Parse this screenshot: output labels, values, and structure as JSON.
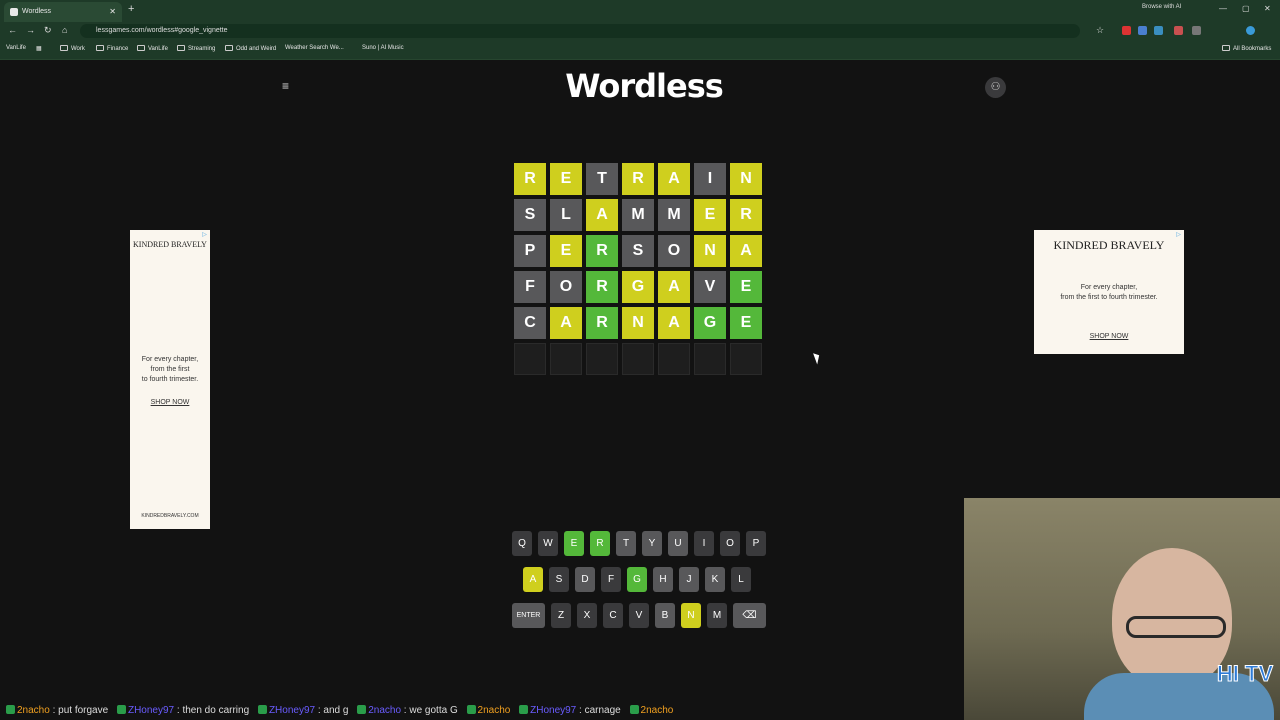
{
  "browser": {
    "tab_title": "Wordless",
    "new_tab": "+",
    "url": "lessgames.com/wordless#google_vignette",
    "browse_ai": "Browse with AI",
    "all_bookmarks": "All Bookmarks",
    "bookmarks": [
      "VanLife",
      "Work",
      "Finance",
      "VanLife",
      "Streaming",
      "Odd and Weird",
      "Weather Search We...",
      "Suno | AI Music"
    ]
  },
  "app": {
    "title": "Wordless",
    "menu_icon": "hamburger-icon",
    "account_icon": "user-icon"
  },
  "colors": {
    "green": "#54b83a",
    "yellow": "#cfcf1e",
    "gray": "#58585a",
    "empty": "#1e1e1e",
    "key_unused": "#3a3a3c"
  },
  "board": {
    "rows": [
      {
        "letters": [
          "R",
          "E",
          "T",
          "R",
          "A",
          "I",
          "N"
        ],
        "states": [
          "y",
          "y",
          "x",
          "y",
          "y",
          "x",
          "y"
        ]
      },
      {
        "letters": [
          "S",
          "L",
          "A",
          "M",
          "M",
          "E",
          "R"
        ],
        "states": [
          "x",
          "x",
          "y",
          "x",
          "x",
          "y",
          "y"
        ]
      },
      {
        "letters": [
          "P",
          "E",
          "R",
          "S",
          "O",
          "N",
          "A"
        ],
        "states": [
          "x",
          "y",
          "g",
          "x",
          "x",
          "y",
          "y"
        ]
      },
      {
        "letters": [
          "F",
          "O",
          "R",
          "G",
          "A",
          "V",
          "E"
        ],
        "states": [
          "x",
          "x",
          "g",
          "y",
          "y",
          "x",
          "g"
        ]
      },
      {
        "letters": [
          "C",
          "A",
          "R",
          "N",
          "A",
          "G",
          "E"
        ],
        "states": [
          "x",
          "y",
          "g",
          "y",
          "y",
          "g",
          "g"
        ]
      },
      {
        "letters": [
          "",
          "",
          "",
          "",
          "",
          "",
          ""
        ],
        "states": [
          "e",
          "e",
          "e",
          "e",
          "e",
          "e",
          "e"
        ]
      }
    ]
  },
  "keyboard": {
    "row1": [
      {
        "k": "Q",
        "s": "u"
      },
      {
        "k": "W",
        "s": "u"
      },
      {
        "k": "E",
        "s": "g"
      },
      {
        "k": "R",
        "s": "g"
      },
      {
        "k": "T",
        "s": "x"
      },
      {
        "k": "Y",
        "s": "x"
      },
      {
        "k": "U",
        "s": "x"
      },
      {
        "k": "I",
        "s": "u"
      },
      {
        "k": "O",
        "s": "u"
      },
      {
        "k": "P",
        "s": "u"
      }
    ],
    "row2": [
      {
        "k": "A",
        "s": "y"
      },
      {
        "k": "S",
        "s": "u"
      },
      {
        "k": "D",
        "s": "x"
      },
      {
        "k": "F",
        "s": "u"
      },
      {
        "k": "G",
        "s": "g"
      },
      {
        "k": "H",
        "s": "x"
      },
      {
        "k": "J",
        "s": "x"
      },
      {
        "k": "K",
        "s": "x"
      },
      {
        "k": "L",
        "s": "u"
      }
    ],
    "row3": [
      {
        "k": "ENTER",
        "s": "x"
      },
      {
        "k": "Z",
        "s": "u"
      },
      {
        "k": "X",
        "s": "u"
      },
      {
        "k": "C",
        "s": "u"
      },
      {
        "k": "V",
        "s": "u"
      },
      {
        "k": "B",
        "s": "x"
      },
      {
        "k": "N",
        "s": "y"
      },
      {
        "k": "M",
        "s": "u"
      },
      {
        "k": "⌫",
        "s": "x"
      }
    ]
  },
  "ads": {
    "left": {
      "brand": "KINDRED BRAVELY",
      "tagline_1": "For every chapter,",
      "tagline_2": "from the first",
      "tagline_3": "to fourth trimester.",
      "cta": "SHOP NOW",
      "domain": "KINDREDBRAVELY.COM"
    },
    "right": {
      "brand": "KINDRED BRAVELY",
      "tagline_1": "For every chapter,",
      "tagline_2": "from the first to fourth trimester.",
      "cta": "SHOP NOW"
    }
  },
  "ticker": [
    {
      "name": "2nacho",
      "msg": ": put forgave"
    },
    {
      "name": "ZHoney97",
      "msg": ": then do carring"
    },
    {
      "name": "ZHoney97",
      "msg": ": and g"
    },
    {
      "name": "2nacho",
      "msg": ": we gotta G"
    },
    {
      "name": "2nacho",
      "msg": ""
    },
    {
      "name": "ZHoney97",
      "msg": ": carnage"
    },
    {
      "name": "2nacho",
      "msg": ""
    }
  ],
  "overlay": {
    "logo": "HI TV"
  }
}
